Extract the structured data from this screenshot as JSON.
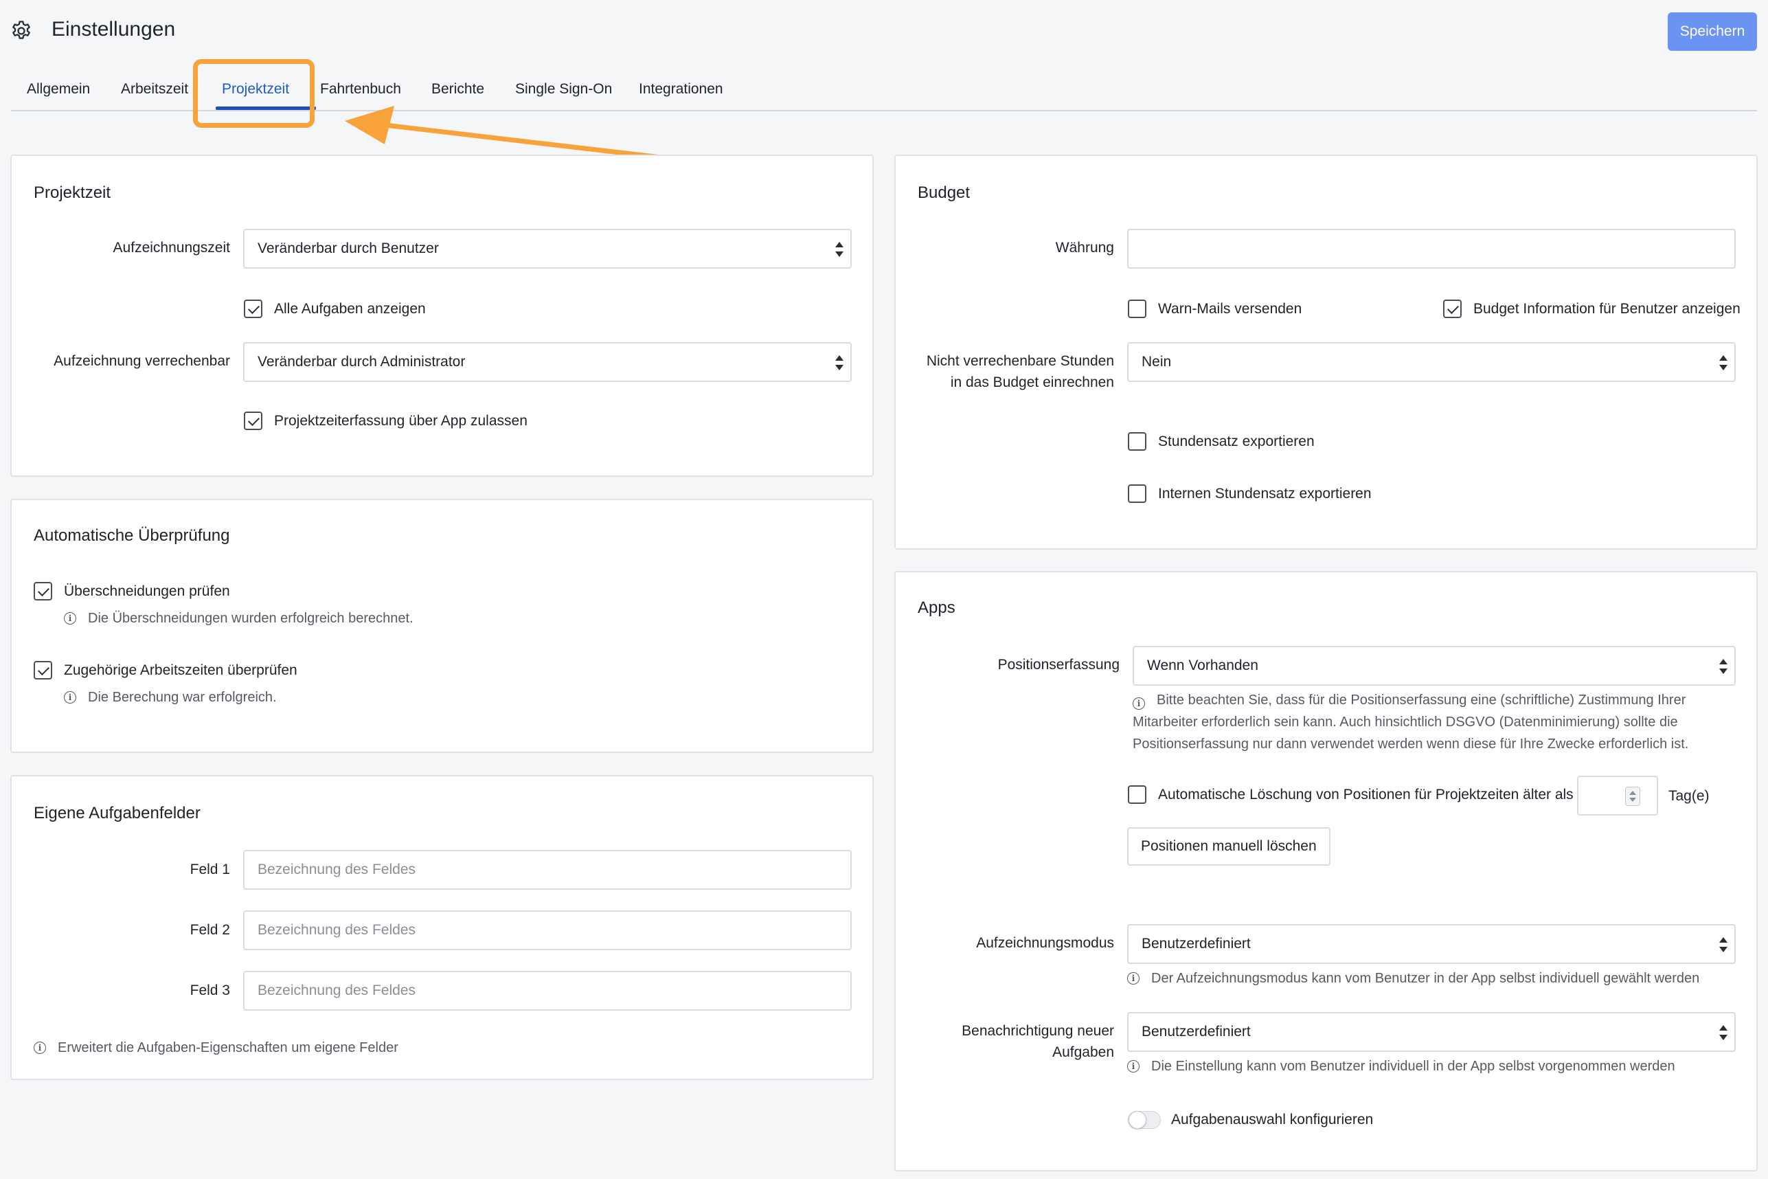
{
  "header": {
    "title": "Einstellungen",
    "save_label": "Speichern"
  },
  "tabs": [
    {
      "label": "Allgemein",
      "active": false
    },
    {
      "label": "Arbeitszeit",
      "active": false
    },
    {
      "label": "Projektzeit",
      "active": true
    },
    {
      "label": "Fahrtenbuch",
      "active": false
    },
    {
      "label": "Berichte",
      "active": false
    },
    {
      "label": "Single Sign-On",
      "active": false
    },
    {
      "label": "Integrationen",
      "active": false
    }
  ],
  "projektzeit": {
    "title": "Projektzeit",
    "recording_time_label": "Aufzeichnungszeit",
    "recording_time_value": "Veränderbar durch Benutzer",
    "show_all_tasks_label": "Alle Aufgaben anzeigen",
    "show_all_tasks_checked": true,
    "billable_label": "Aufzeichnung verrechenbar",
    "billable_value": "Veränderbar durch Administrator",
    "app_recording_label": "Projektzeiterfassung über App zulassen",
    "app_recording_checked": true
  },
  "auto_check": {
    "title": "Automatische Überprüfung",
    "overlap_label": "Überschneidungen prüfen",
    "overlap_checked": true,
    "overlap_info": "Die Überschneidungen wurden erfolgreich berechnet.",
    "worktime_label": "Zugehörige Arbeitszeiten überprüfen",
    "worktime_checked": true,
    "worktime_info": "Die Berechung war erfolgreich."
  },
  "custom_fields": {
    "title": "Eigene Aufgabenfelder",
    "fields": [
      {
        "label": "Feld 1",
        "placeholder": "Bezeichnung des Feldes"
      },
      {
        "label": "Feld 2",
        "placeholder": "Bezeichnung des Feldes"
      },
      {
        "label": "Feld 3",
        "placeholder": "Bezeichnung des Feldes"
      }
    ],
    "info": "Erweitert die Aufgaben-Eigenschaften um eigene Felder"
  },
  "budget": {
    "title": "Budget",
    "currency_label": "Währung",
    "currency_value": "",
    "warn_mails_label": "Warn-Mails versenden",
    "warn_mails_checked": false,
    "budget_info_label": "Budget Information für Benutzer anzeigen",
    "budget_info_checked": true,
    "nonbillable_label_line1": "Nicht verrechenbare Stunden",
    "nonbillable_label_line2": "in das Budget einrechnen",
    "nonbillable_value": "Nein",
    "export_rate_label": "Stundensatz exportieren",
    "export_rate_checked": false,
    "export_internal_rate_label": "Internen Stundensatz exportieren",
    "export_internal_rate_checked": false
  },
  "apps": {
    "title": "Apps",
    "position_label": "Positionserfassung",
    "position_value": "Wenn Vorhanden",
    "position_info_line1": "Bitte beachten Sie, dass für die Positionserfassung eine (schriftliche) Zustimmung Ihrer",
    "position_info_line2": "Mitarbeiter erforderlich sein kann. Auch hinsichtlich DSGVO (Datenminimierung) sollte die",
    "position_info_line3": "Positionserfassung nur dann verwendet werden wenn diese für Ihre Zwecke erforderlich ist.",
    "auto_delete_label": "Automatische Löschung von Positionen für Projektzeiten älter als",
    "auto_delete_checked": false,
    "auto_delete_days": "",
    "days_unit": "Tag(e)",
    "delete_manual_label": "Positionen manuell löschen",
    "mode_label": "Aufzeichnungsmodus",
    "mode_value": "Benutzerdefiniert",
    "mode_info": "Der Aufzeichnungsmodus kann vom Benutzer in der App selbst individuell gewählt werden",
    "notify_label_line1": "Benachrichtigung neuer",
    "notify_label_line2": "Aufgaben",
    "notify_value": "Benutzerdefiniert",
    "notify_info": "Die Einstellung kann vom Benutzer individuell in der App selbst vorgenommen werden",
    "task_select_label": "Aufgabenauswahl konfigurieren",
    "task_select_on": false
  },
  "colors": {
    "accent": "#1f4fb8",
    "save_button": "#6b93f3",
    "highlight_annotation": "#f7a33a"
  }
}
